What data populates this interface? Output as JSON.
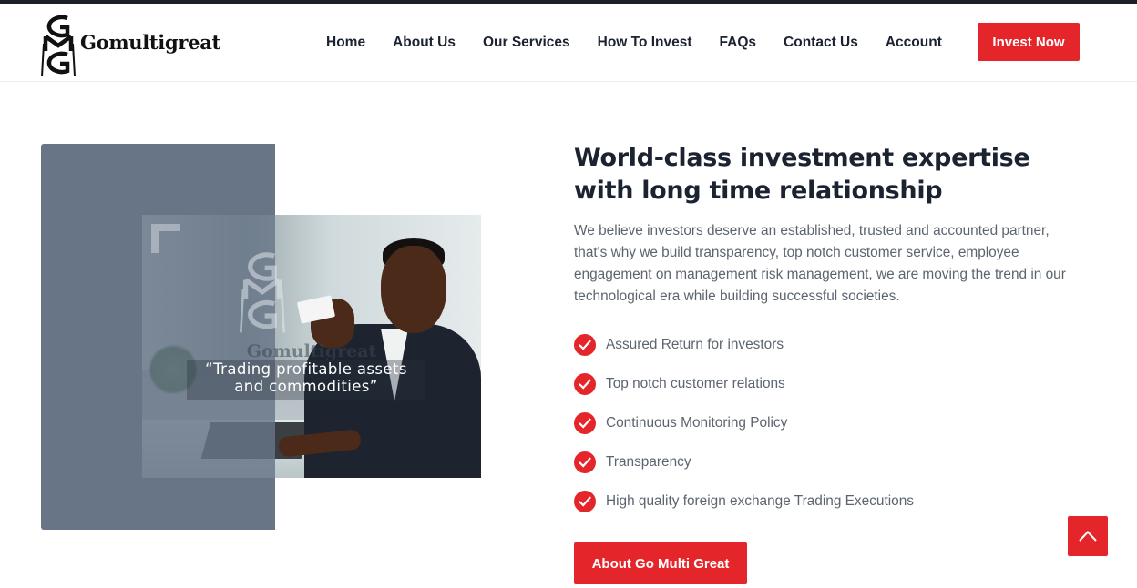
{
  "brand": {
    "name": "Gomultigreat",
    "logo_icon": "gmg-monogram"
  },
  "nav": {
    "items": [
      "Home",
      "About Us",
      "Our Services",
      "How To Invest",
      "FAQs",
      "Contact Us",
      "Account"
    ],
    "cta": "Invest Now"
  },
  "hero": {
    "image": {
      "watermark_brand": "Gomultigreat",
      "quote_line1": "“Trading profitable assets",
      "quote_line2": "and commodities”"
    },
    "title": "World-class investment expertise with long time relationship",
    "paragraph": "We believe investors deserve an established, trusted and accounted partner, that's why we build transparency, top notch customer service, employee engagement on management risk management, we are moving the trend in our technological era while building successful societies.",
    "features": [
      "Assured Return for investors",
      "Top notch customer relations",
      "Continuous Monitoring Policy",
      "Transparency",
      "High quality foreign exchange Trading Executions"
    ],
    "button": "About Go Multi Great"
  },
  "colors": {
    "accent": "#e4262b",
    "slate": "#677587",
    "heading": "#1b2230",
    "body_text": "#5c6470"
  },
  "icons": {
    "check": "check-circle-icon",
    "scroll_top": "chevron-up-icon"
  }
}
